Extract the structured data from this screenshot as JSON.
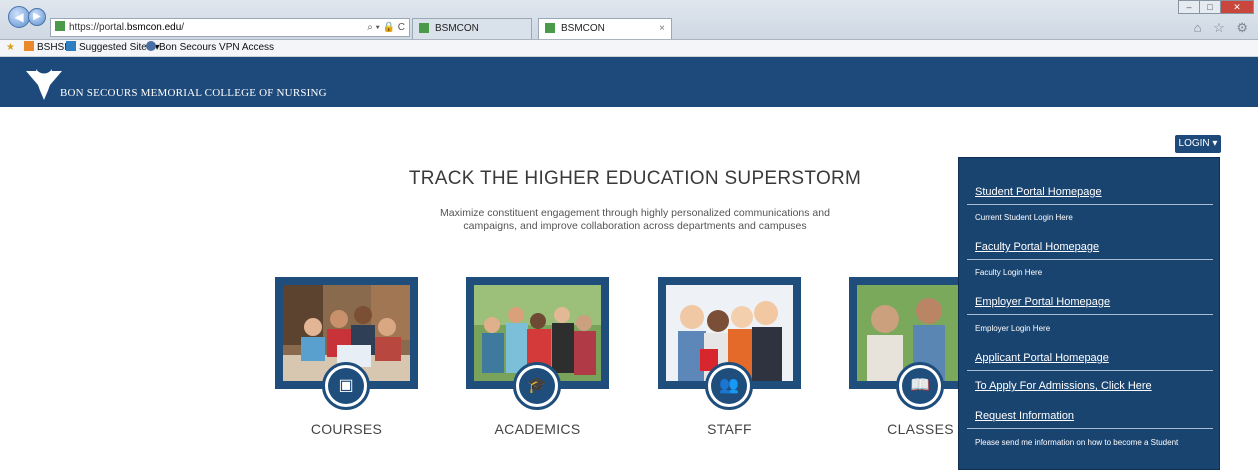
{
  "browser": {
    "url_prefix": "https://portal.",
    "url_host": "bsmcon.edu",
    "url_suffix": "/",
    "url_tools": "⌕ ▾ 🔒 C",
    "tabs": [
      {
        "label": "BSMCON"
      },
      {
        "label": "BSMCON",
        "close": "×"
      }
    ],
    "window_controls": {
      "minimize": "–",
      "maximize": "□",
      "close": "✕"
    },
    "toolbar_icons": "⌂ ☆ ⚙"
  },
  "favorites": [
    {
      "label": "BSHSI",
      "color": "#e9892b"
    },
    {
      "label": "Suggested Sites ▾",
      "color": "#2d7fc1"
    },
    {
      "label": "Bon Secours VPN Access",
      "color": "#4a6fa5"
    }
  ],
  "site": {
    "name": "BON SECOURS MEMORIAL COLLEGE OF NURSING",
    "brand_color": "#1d4a7a"
  },
  "login": {
    "button": "LOGIN ▾",
    "items": [
      {
        "link": "Student Portal Homepage",
        "sub": "Current Student Login Here"
      },
      {
        "link": "Faculty Portal Homepage",
        "sub": "Faculty Login Here"
      },
      {
        "link": "Employer Portal Homepage",
        "sub": "Employer Login Here"
      },
      {
        "link": "Applicant Portal Homepage",
        "sub": ""
      },
      {
        "link": "To Apply For Admissions, Click Here",
        "sub": ""
      },
      {
        "link": "Request Information",
        "sub": "Please send me information on how to become a Student"
      }
    ]
  },
  "main": {
    "title": "TRACK THE HIGHER EDUCATION SUPERSTORM",
    "description": "Maximize constituent engagement through highly personalized communications and campaigns, and improve collaboration across departments and campuses",
    "cards": [
      {
        "label": "COURSES",
        "icon": "presentation-icon",
        "glyph": "▣"
      },
      {
        "label": "ACADEMICS",
        "icon": "graduation-cap-icon",
        "glyph": "🎓"
      },
      {
        "label": "STAFF",
        "icon": "people-icon",
        "glyph": "👥"
      },
      {
        "label": "CLASSES",
        "icon": "book-icon",
        "glyph": "📖"
      }
    ]
  }
}
